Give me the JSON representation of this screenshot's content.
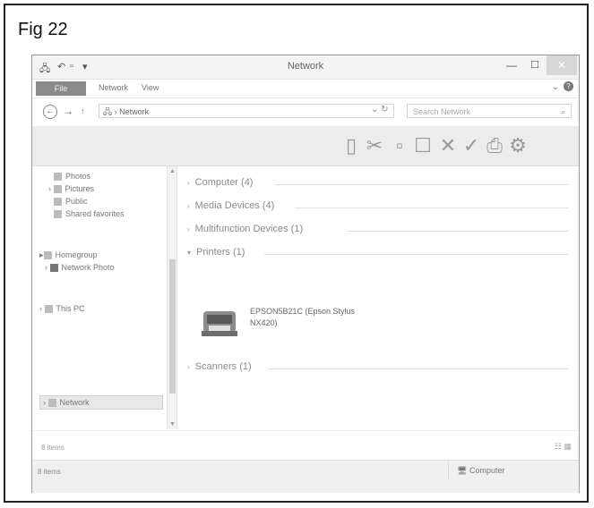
{
  "figure": {
    "label": "Fig 22"
  },
  "window": {
    "title": "Network",
    "controls": {
      "minimize": "—",
      "maximize": "☐",
      "close": "✕"
    }
  },
  "ribbon": {
    "tabs": [
      "File",
      "Network",
      "View"
    ]
  },
  "address": {
    "path": "Network",
    "search_placeholder": "Search Network"
  },
  "toolbar": {
    "buttons": [
      "properties",
      "cut",
      "copy",
      "delete",
      "check",
      "print",
      "settings"
    ]
  },
  "nav_pane": {
    "items": [
      {
        "label": "Photos",
        "icon": "folder-icon"
      },
      {
        "label": "Pictures",
        "icon": "folder-icon"
      },
      {
        "label": "Public",
        "icon": "folder-icon"
      },
      {
        "label": "Shared favorites",
        "icon": "folder-icon"
      },
      {
        "label": "Homegroup",
        "icon": "homegroup-icon"
      },
      {
        "label": "Network Photo",
        "icon": "network-photo-icon"
      },
      {
        "label": "This PC",
        "icon": "computer-icon"
      },
      {
        "label": "Network",
        "icon": "network-icon"
      }
    ]
  },
  "content": {
    "groups": [
      {
        "label": "Computer (4)",
        "expanded": false
      },
      {
        "label": "Media Devices (4)",
        "expanded": false
      },
      {
        "label": "Multifunction Devices (1)",
        "expanded": false
      },
      {
        "label": "Printers (1)",
        "expanded": true
      },
      {
        "label": "Scanners (1)",
        "expanded": false
      }
    ],
    "printer": {
      "name_line1": "EPSON5B21C (Epson Stylus",
      "name_line2": "NX420)"
    }
  },
  "status": {
    "items_count": "8 items",
    "bottom_count": "8 items",
    "computer_label": "Computer"
  }
}
